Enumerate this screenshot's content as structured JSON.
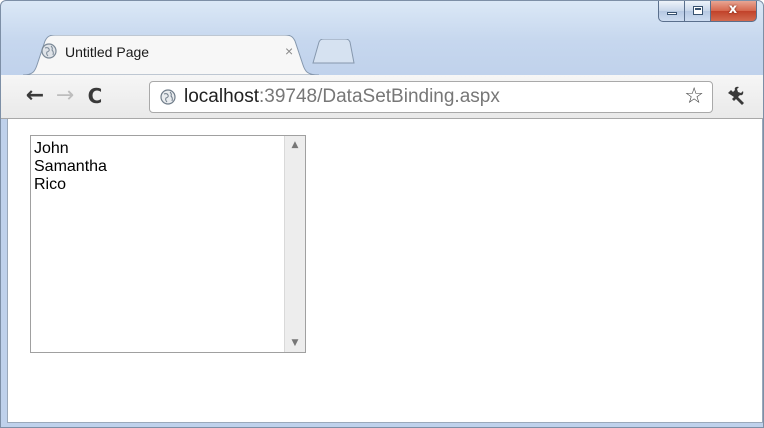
{
  "browser": {
    "tab": {
      "title": "Untitled Page",
      "close_glyph": "×"
    },
    "window_controls": {
      "close_glyph": "x"
    },
    "toolbar": {
      "back_glyph": "←",
      "forward_glyph": "→",
      "reload_glyph": "C",
      "url_host": "localhost",
      "url_rest": ":39748/DataSetBinding.aspx",
      "bookmark_glyph": "☆"
    },
    "icons": {
      "favicon": "globe-icon",
      "omnibox": "globe-icon",
      "settings": "wrench-icon"
    }
  },
  "page": {
    "listbox": {
      "items": [
        "John",
        "Samantha",
        "Rico"
      ],
      "scroll_up_glyph": "▲",
      "scroll_down_glyph": "▼"
    }
  },
  "colors": {
    "frame": "#bfd1eb",
    "close_button": "#c1422a",
    "toolbar": "#eeeeee"
  }
}
